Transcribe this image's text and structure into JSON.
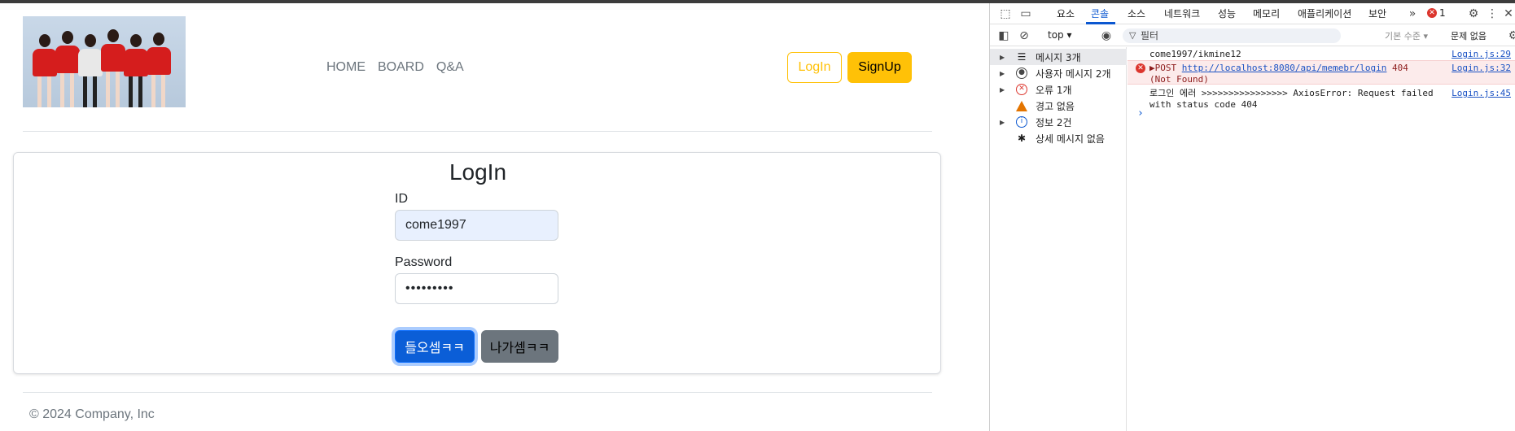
{
  "page": {
    "nav": [
      "HOME",
      "BOARD",
      "Q&A"
    ],
    "login_button": "LogIn",
    "signup_button": "SignUp",
    "card_title": "LogIn",
    "id_label": "ID",
    "id_value": "come1997",
    "password_label": "Password",
    "password_value": "•••••••••",
    "enter_button": "들오셈ㅋㅋ",
    "exit_button": "나가셈ㅋㅋ",
    "footer": "© 2024 Company, Inc",
    "colors": {
      "accent": "#ffc107",
      "primary": "#0b5ed7",
      "secondary": "#6c757d"
    }
  },
  "devtools": {
    "tabs": [
      "요소",
      "콘솔",
      "소스",
      "네트워크",
      "성능",
      "메모리",
      "애플리케이션",
      "보안"
    ],
    "active_tab": "콘솔",
    "error_count": "1",
    "context": "top",
    "filter_placeholder": "필터",
    "log_level": "기본 수준",
    "issues": "문제 없음",
    "sidebar": [
      {
        "label": "메시지 3개",
        "icon": "list-icon"
      },
      {
        "label": "사용자 메시지 2개",
        "icon": "user-icon"
      },
      {
        "label": "오류 1개",
        "icon": "error-icon"
      },
      {
        "label": "경고 없음",
        "icon": "warning-icon"
      },
      {
        "label": "정보 2건",
        "icon": "info-icon"
      },
      {
        "label": "상세 메시지 없음",
        "icon": "bug-icon"
      }
    ],
    "logs": [
      {
        "text": "come1997/ikmine12",
        "source": "Login.js:29"
      },
      {
        "prefix": "▶POST ",
        "url": "http://localhost:8080/api/memebr/login",
        "suffix": " 404",
        "line2": "(Not Found)",
        "source": "Login.js:32"
      },
      {
        "text": "로그인 에러 >>>>>>>>>>>>>>>> AxiosError: Request failed",
        "line2": "with status code 404",
        "source": "Login.js:45"
      }
    ]
  }
}
